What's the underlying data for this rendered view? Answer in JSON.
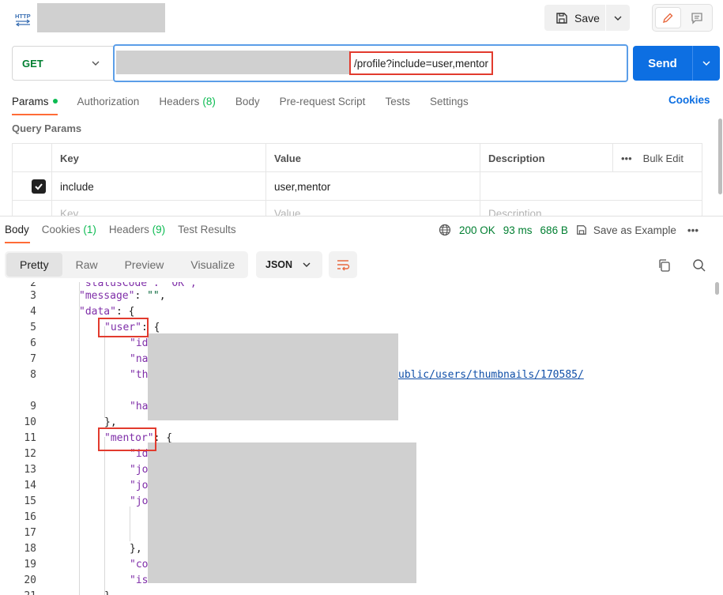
{
  "header": {
    "method_icon": "http-icon",
    "save_label": "Save"
  },
  "request": {
    "method": "GET",
    "url_path": "/profile?include=user,mentor",
    "send_label": "Send",
    "tabs": [
      {
        "label": "Params",
        "badge": "",
        "dot": true
      },
      {
        "label": "Authorization",
        "badge": ""
      },
      {
        "label": "Headers",
        "badge": "(8)"
      },
      {
        "label": "Body",
        "badge": ""
      },
      {
        "label": "Pre-request Script",
        "badge": ""
      },
      {
        "label": "Tests",
        "badge": ""
      },
      {
        "label": "Settings",
        "badge": ""
      }
    ],
    "cookies_label": "Cookies"
  },
  "query_params": {
    "title": "Query Params",
    "headers": {
      "key": "Key",
      "value": "Value",
      "description": "Description",
      "bulk_edit": "Bulk Edit"
    },
    "rows": [
      {
        "checked": true,
        "key": "include",
        "value": "user,mentor",
        "description": ""
      }
    ],
    "placeholder": {
      "key": "Key",
      "value": "Value",
      "description": "Description"
    }
  },
  "response": {
    "tabs": [
      {
        "label": "Body"
      },
      {
        "label": "Cookies",
        "badge": "(1)"
      },
      {
        "label": "Headers",
        "badge": "(9)"
      },
      {
        "label": "Test Results"
      }
    ],
    "status": "200 OK",
    "time": "93 ms",
    "size": "686 B",
    "save_example": "Save as Example",
    "formats": [
      "Pretty",
      "Raw",
      "Preview",
      "Visualize"
    ],
    "active_format": "Pretty",
    "language": "JSON"
  },
  "code_lines": [
    {
      "n": "2",
      "text": "\"statusCode\": \"OK\","
    },
    {
      "n": "3",
      "key": "\"message\"",
      "rest": ": ",
      "str": "\"\"",
      "tail": ","
    },
    {
      "n": "4",
      "key": "\"data\"",
      "rest": ": {"
    },
    {
      "n": "5",
      "key": "\"user\"",
      "rest": ": {"
    },
    {
      "n": "6",
      "key": "\"id"
    },
    {
      "n": "7",
      "key": "\"nam"
    },
    {
      "n": "8",
      "key": "\"th",
      "url": "ublic/users/thumbnails/170585/"
    },
    {
      "n": "9",
      "key": "\"ha"
    },
    {
      "n": "10",
      "text": "},"
    },
    {
      "n": "11",
      "key": "\"mentor\"",
      "rest": ": {"
    },
    {
      "n": "12",
      "key": "\"id"
    },
    {
      "n": "13",
      "key": "\"jo"
    },
    {
      "n": "14",
      "key": "\"jo"
    },
    {
      "n": "15",
      "key": "\"jo"
    },
    {
      "n": "16",
      "text": ""
    },
    {
      "n": "17",
      "text": ""
    },
    {
      "n": "18",
      "text": "},"
    },
    {
      "n": "19",
      "key": "\"com"
    },
    {
      "n": "20",
      "key": "\"is"
    },
    {
      "n": "21",
      "text": "}"
    }
  ]
}
